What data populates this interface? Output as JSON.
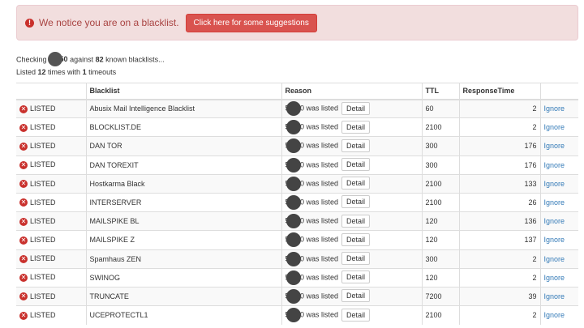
{
  "alert": {
    "icon": "exclamation-circle-icon",
    "message": "We notice you are on a blacklist.",
    "button_label": "Click here for some suggestions",
    "colors": {
      "background": "#f2dede",
      "text": "#a94442",
      "button": "#d9534f"
    }
  },
  "summary": {
    "checking_prefix": "Checking ",
    "ip_start": "5",
    "ip_end": ".50",
    "against_text": " against ",
    "blacklist_count": "82",
    "known_text": " known blacklists...",
    "listed_prefix": "Listed ",
    "listed_count": "12",
    "times_with_text": " times with ",
    "timeouts_count": "1",
    "timeouts_text": " timeouts"
  },
  "table": {
    "columns": [
      "",
      "Blacklist",
      "Reason",
      "TTL",
      "ResponseTime",
      ""
    ],
    "rows": [
      {
        "status": "LISTED",
        "blacklist": "Abusix Mail Intelligence Blacklist",
        "reason_start": "5",
        "reason_end": ".50 was listed",
        "detail": "Detail",
        "ttl": "60",
        "response": "2",
        "action": "Ignore"
      },
      {
        "status": "LISTED",
        "blacklist": "BLOCKLIST.DE",
        "reason_start": "5",
        "reason_end": ".50 was listed",
        "detail": "Detail",
        "ttl": "2100",
        "response": "2",
        "action": "Ignore"
      },
      {
        "status": "LISTED",
        "blacklist": "DAN TOR",
        "reason_start": "5",
        "reason_end": ".50 was listed",
        "detail": "Detail",
        "ttl": "300",
        "response": "176",
        "action": "Ignore"
      },
      {
        "status": "LISTED",
        "blacklist": "DAN TOREXIT",
        "reason_start": "5",
        "reason_end": ".50 was listed",
        "detail": "Detail",
        "ttl": "300",
        "response": "176",
        "action": "Ignore"
      },
      {
        "status": "LISTED",
        "blacklist": "Hostkarma Black",
        "reason_start": "5",
        "reason_end": ".50 was listed",
        "detail": "Detail",
        "ttl": "2100",
        "response": "133",
        "action": "Ignore"
      },
      {
        "status": "LISTED",
        "blacklist": "INTERSERVER",
        "reason_start": "5",
        "reason_end": ".50 was listed",
        "detail": "Detail",
        "ttl": "2100",
        "response": "26",
        "action": "Ignore"
      },
      {
        "status": "LISTED",
        "blacklist": "MAILSPIKE BL",
        "reason_start": "5",
        "reason_end": ".50 was listed",
        "detail": "Detail",
        "ttl": "120",
        "response": "136",
        "action": "Ignore"
      },
      {
        "status": "LISTED",
        "blacklist": "MAILSPIKE Z",
        "reason_start": "5",
        "reason_end": ".50 was listed",
        "detail": "Detail",
        "ttl": "120",
        "response": "137",
        "action": "Ignore"
      },
      {
        "status": "LISTED",
        "blacklist": "Spamhaus ZEN",
        "reason_start": "5",
        "reason_end": ".50 was listed",
        "detail": "Detail",
        "ttl": "300",
        "response": "2",
        "action": "Ignore"
      },
      {
        "status": "LISTED",
        "blacklist": "SWINOG",
        "reason_start": "5",
        "reason_end": ".50 was listed",
        "detail": "Detail",
        "ttl": "120",
        "response": "2",
        "action": "Ignore"
      },
      {
        "status": "LISTED",
        "blacklist": "TRUNCATE",
        "reason_start": "5",
        "reason_end": ".50 was listed",
        "detail": "Detail",
        "ttl": "7200",
        "response": "39",
        "action": "Ignore"
      },
      {
        "status": "LISTED",
        "blacklist": "UCEPROTECTL1",
        "reason_start": "5",
        "reason_end": ".50 was listed",
        "detail": "Detail",
        "ttl": "2100",
        "response": "2",
        "action": "Ignore"
      }
    ],
    "status_icon": "x-circle-icon",
    "link_color": "#337ab7"
  }
}
